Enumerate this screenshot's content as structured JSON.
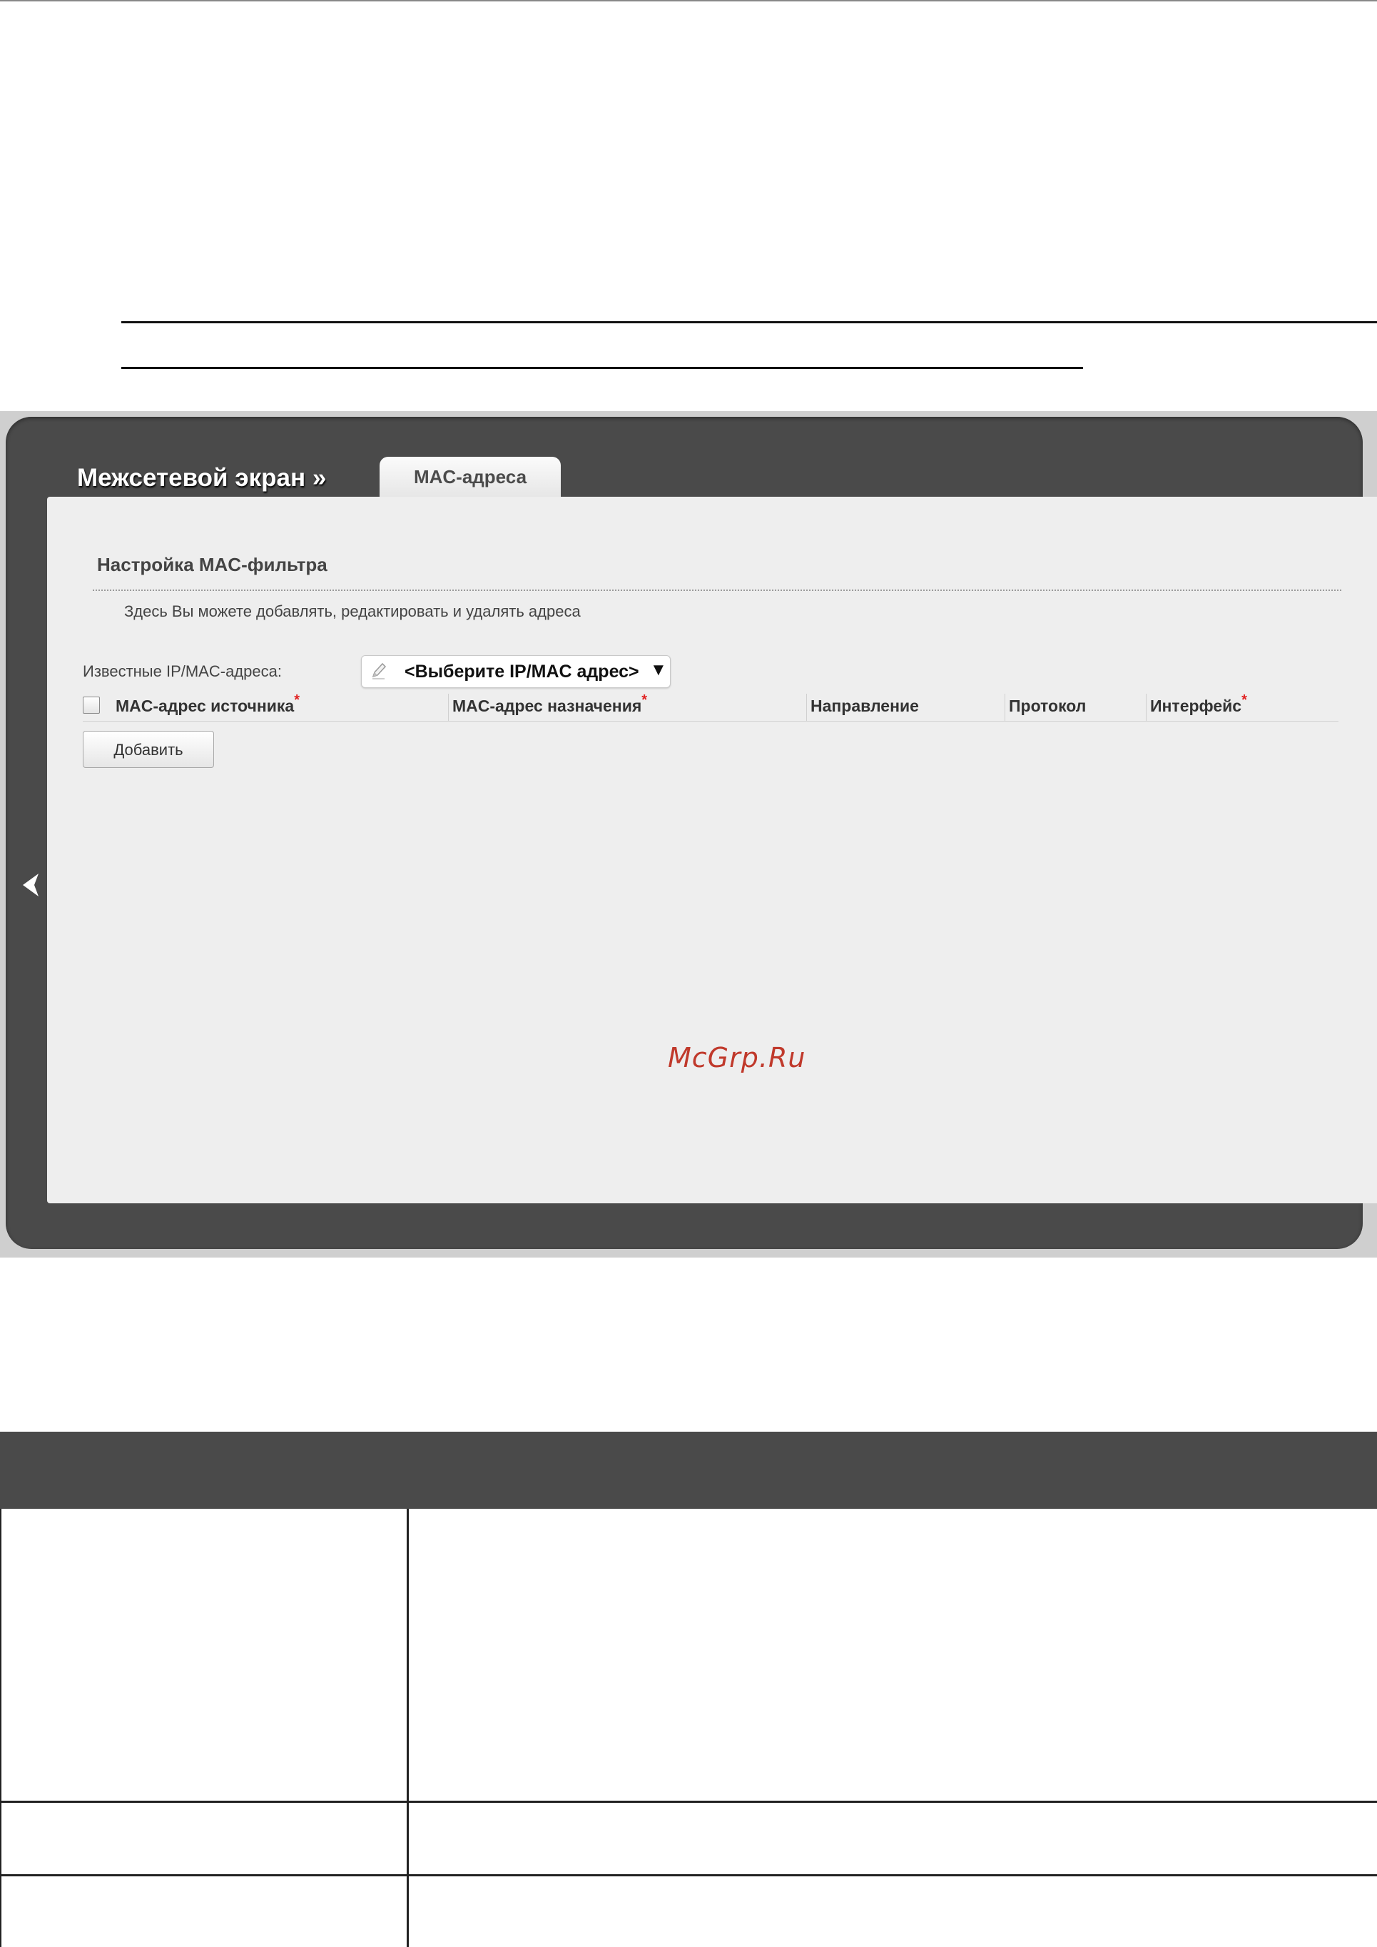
{
  "breadcrumb": {
    "title": "Межсетевой экран »"
  },
  "tabs": [
    {
      "label": "MAC-адреса",
      "active": true
    }
  ],
  "section": {
    "title": "Настройка MAC-фильтра",
    "description": "Здесь Вы можете добавлять, редактировать и удалять адреса"
  },
  "known_addresses": {
    "label": "Известные IP/MAC-адреса:",
    "selected": "<Выберите IP/MAC адрес>",
    "arrow": "▼"
  },
  "table": {
    "columns": [
      {
        "label": "MAC-адрес источника",
        "required": "*"
      },
      {
        "label": "MAC-адрес назначения",
        "required": "*"
      },
      {
        "label": "Направление",
        "required": ""
      },
      {
        "label": "Протокол",
        "required": ""
      },
      {
        "label": "Интерфейс",
        "required": "*"
      }
    ]
  },
  "buttons": {
    "add": "Добавить"
  },
  "watermark": "McGrp.Ru",
  "colors": {
    "frame": "#4a4a4a",
    "content_bg": "#eeeeee",
    "required_mark": "#e02020",
    "watermark": "#c0392b"
  },
  "icons": {
    "edit": "pencil-icon",
    "back": "chevron-left-icon"
  }
}
